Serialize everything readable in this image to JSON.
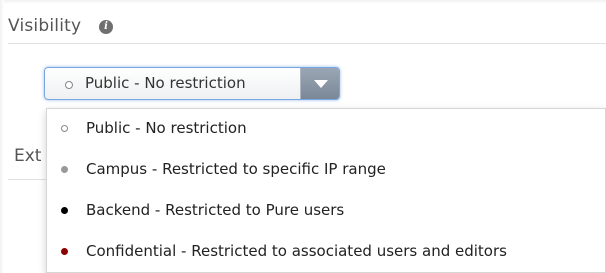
{
  "section": {
    "title": "Visibility",
    "info_icon": "info-icon"
  },
  "select": {
    "selected_label": "Public - No restriction",
    "selected_dot_color": "#ffffff",
    "arrow_icon": "chevron-down-icon"
  },
  "behind": {
    "label": "Ext"
  },
  "options": [
    {
      "label": "Public - No restriction",
      "dot_color": "#ffffff",
      "dot_style": "hollow"
    },
    {
      "label": "Campus - Restricted to specific IP range",
      "dot_color": "#999999",
      "dot_style": "filled"
    },
    {
      "label": "Backend - Restricted to Pure users",
      "dot_color": "#000000",
      "dot_style": "filled"
    },
    {
      "label": "Confidential - Restricted to associated users and editors",
      "dot_color": "#8b0000",
      "dot_style": "filled"
    }
  ],
  "colors": {
    "accent_border": "#7aa7e0",
    "arrow_bg": "#8995a4"
  }
}
